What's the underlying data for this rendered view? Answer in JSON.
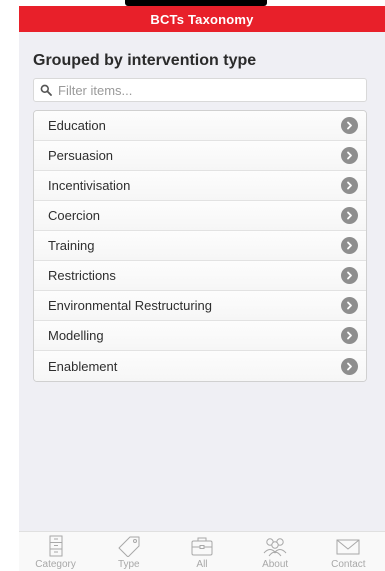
{
  "header": {
    "title": "BCTs Taxonomy"
  },
  "section": {
    "title": "Grouped by intervention type"
  },
  "search": {
    "placeholder": "Filter items..."
  },
  "list": {
    "items": [
      {
        "label": "Education"
      },
      {
        "label": "Persuasion"
      },
      {
        "label": "Incentivisation"
      },
      {
        "label": "Coercion"
      },
      {
        "label": "Training"
      },
      {
        "label": "Restrictions"
      },
      {
        "label": "Environmental Restructuring"
      },
      {
        "label": "Modelling"
      },
      {
        "label": "Enablement"
      }
    ]
  },
  "tabbar": {
    "tabs": [
      {
        "label": "Category",
        "icon": "cabinet-icon"
      },
      {
        "label": "Type",
        "icon": "tag-icon"
      },
      {
        "label": "All",
        "icon": "toolbox-icon"
      },
      {
        "label": "About",
        "icon": "people-icon"
      },
      {
        "label": "Contact",
        "icon": "envelope-icon"
      }
    ]
  },
  "colors": {
    "header": "#e8202a",
    "background": "#efeff4",
    "chevron": "#8e8e8e",
    "tab_inactive": "#a8a8a8"
  }
}
